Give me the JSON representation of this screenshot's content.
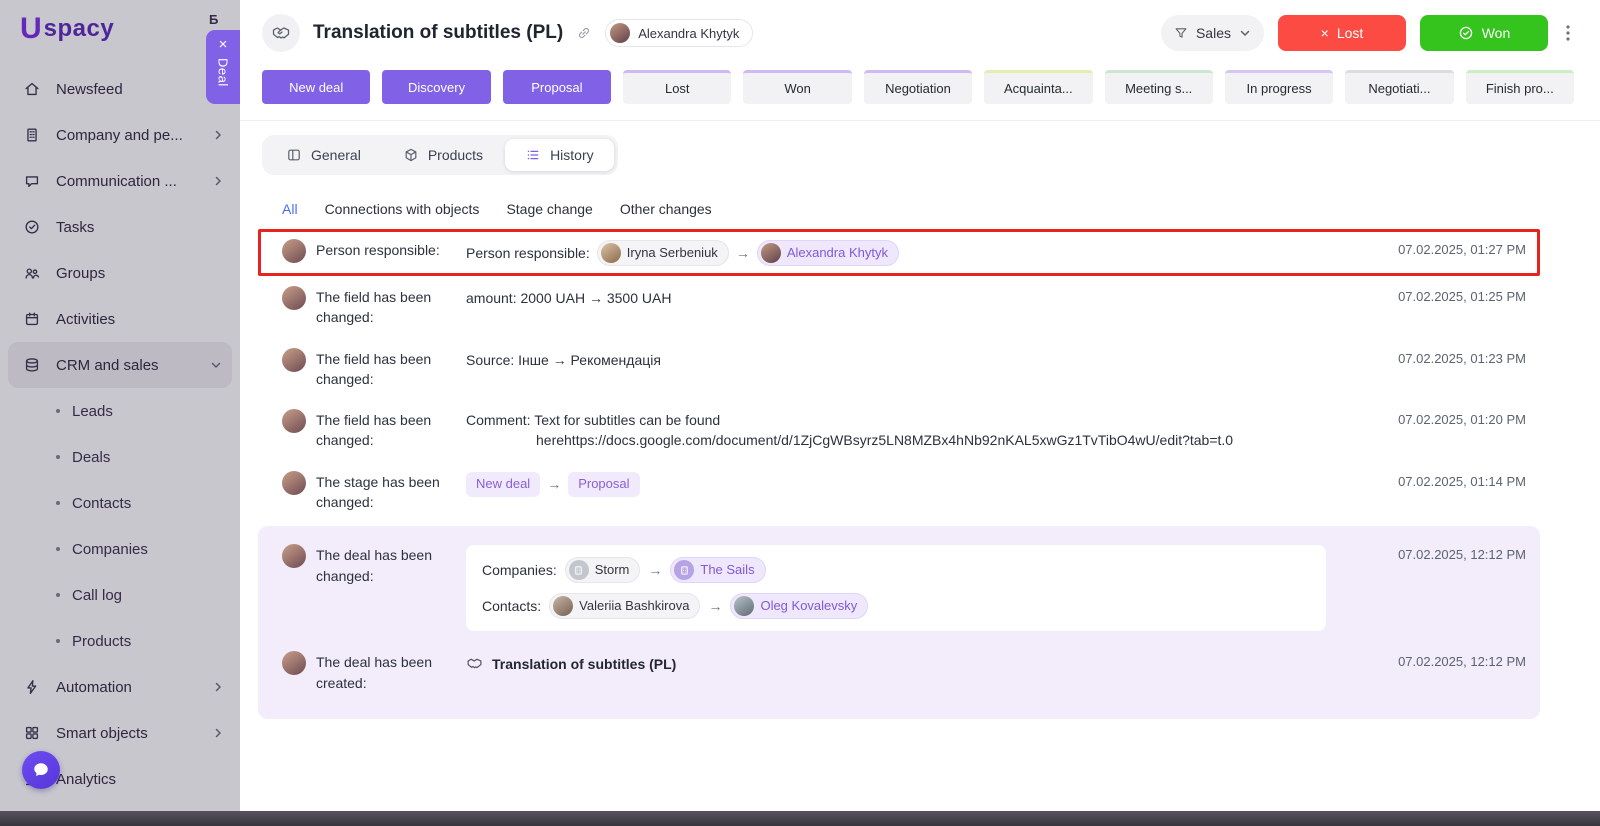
{
  "colors": {
    "accent_purple": "#8161e6",
    "brand_purple": "#7b2fe0",
    "lost_red": "#fb4b42",
    "won_green": "#35c31e",
    "lavender_bg": "#f2ecfb",
    "highlight_red": "#e8231d",
    "active_filter_blue": "#4c6ef5"
  },
  "glyphs": {
    "arrow": "→",
    "close": "×"
  },
  "brand": {
    "logo_letter": "U",
    "logo_text": "spacy"
  },
  "underlying": {
    "remnant_text": "Б"
  },
  "sidebar": {
    "items": [
      {
        "label": "Newsfeed"
      },
      {
        "label": "Company and pe..."
      },
      {
        "label": "Communication ..."
      },
      {
        "label": "Tasks"
      },
      {
        "label": "Groups"
      },
      {
        "label": "Activities"
      },
      {
        "label": "CRM and sales"
      },
      {
        "label": "Leads"
      },
      {
        "label": "Deals"
      },
      {
        "label": "Contacts"
      },
      {
        "label": "Companies"
      },
      {
        "label": "Call log"
      },
      {
        "label": "Products"
      },
      {
        "label": "Automation"
      },
      {
        "label": "Smart objects"
      },
      {
        "label": "Analytics"
      }
    ]
  },
  "deal": {
    "tab_label": "Deal",
    "title": "Translation of subtitles (PL)",
    "owner": "Alexandra Khytyk",
    "funnel_label": "Sales",
    "lost_label": "Lost",
    "won_label": "Won"
  },
  "pipeline": {
    "stages": [
      {
        "label": "New deal",
        "filled": true
      },
      {
        "label": "Discovery",
        "filled": true
      },
      {
        "label": "Proposal",
        "filled": true
      },
      {
        "label": "Lost",
        "accent": "#cdbcf4"
      },
      {
        "label": "Won",
        "accent": "#cdbcf4"
      },
      {
        "label": "Negotiation",
        "accent": "#cdbcf4"
      },
      {
        "label": "Acquainta...",
        "accent": "#e3edb4"
      },
      {
        "label": "Meeting s...",
        "accent": "#cbe7d4"
      },
      {
        "label": "In progress",
        "accent": "#d4c8f2"
      },
      {
        "label": "Negotiati...",
        "accent": "#dcdce0"
      },
      {
        "label": "Finish pro...",
        "accent": "#cdeec4"
      }
    ]
  },
  "tabs": [
    {
      "label": "General"
    },
    {
      "label": "Products"
    },
    {
      "label": "History",
      "active": true
    }
  ],
  "filters": [
    {
      "label": "All",
      "active": true
    },
    {
      "label": "Connections with objects"
    },
    {
      "label": "Stage change"
    },
    {
      "label": "Other changes"
    }
  ],
  "history": {
    "rows": [
      {
        "label": "Person responsible:",
        "prefix": "Person responsible:",
        "from_chip": "Iryna Serbeniuk",
        "to_chip": "Alexandra Khytyk",
        "date": "07.02.2025, 01:27 PM"
      },
      {
        "label": "The field has been changed:",
        "text": "amount: 2000 UAH → 3500 UAH",
        "date": "07.02.2025, 01:25 PM"
      },
      {
        "label": "The field has been changed:",
        "text": "Source: Інше → Рекомендація",
        "date": "07.02.2025, 01:23 PM"
      },
      {
        "label": "The field has been changed:",
        "text_line1": "Comment: Text for subtitles can be found",
        "text_line2": "herehttps://docs.google.com/document/d/1ZjCgWBsyrz5LN8MZBx4hNb92nKAL5xwGz1TvTibO4wU/edit?tab=t.0",
        "date": "07.02.2025, 01:20 PM"
      },
      {
        "label": "The stage has been changed:",
        "from_stage": "New deal",
        "to_stage": "Proposal",
        "date": "07.02.2025, 01:14 PM"
      },
      {
        "label": "The deal has been changed:",
        "companies_label": "Companies:",
        "companies_from": "Storm",
        "companies_to": "The Sails",
        "contacts_label": "Contacts:",
        "contacts_from": "Valeriia Bashkirova",
        "contacts_to": "Oleg Kovalevsky",
        "date": "07.02.2025, 12:12 PM"
      },
      {
        "label": "The deal has been created:",
        "text": "Translation of subtitles (PL)",
        "date": "07.02.2025, 12:12 PM"
      }
    ]
  }
}
